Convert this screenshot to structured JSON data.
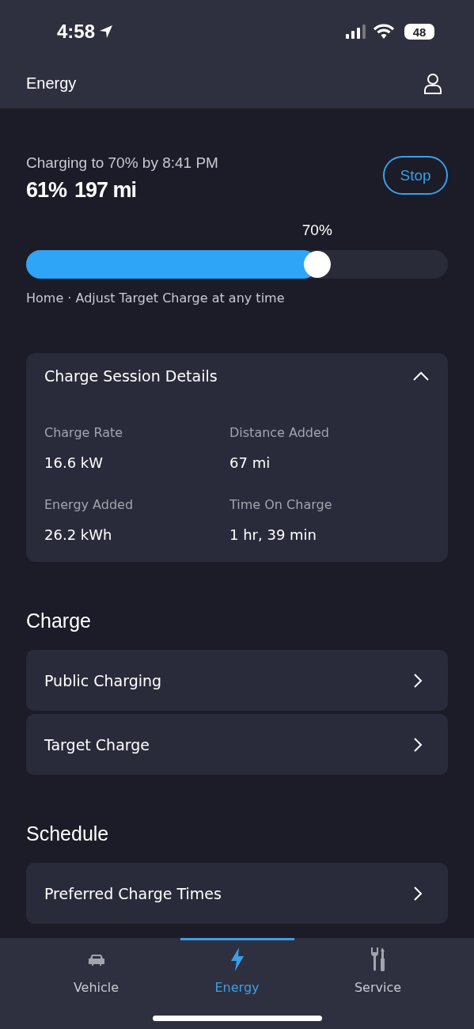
{
  "status_bar": {
    "time": "4:58",
    "battery": "48"
  },
  "header": {
    "title": "Energy"
  },
  "charging": {
    "status": "Charging to 70% by 8:41 PM",
    "percent": "61%",
    "range": "197 mi",
    "stop_button": "Stop",
    "target_label": "70%",
    "level": 0.69,
    "caption": "Home · Adjust Target Charge at any time"
  },
  "session": {
    "title": "Charge Session Details",
    "expanded": true,
    "details": [
      {
        "label": "Charge Rate",
        "value": "16.6 kW"
      },
      {
        "label": "Distance Added",
        "value": "67 mi"
      },
      {
        "label": "Energy Added",
        "value": "26.2 kWh"
      },
      {
        "label": "Time On Charge",
        "value": "1 hr, 39 min"
      }
    ]
  },
  "sections": [
    {
      "title": "Charge",
      "items": [
        {
          "label": "Public Charging"
        },
        {
          "label": "Target Charge"
        }
      ]
    },
    {
      "title": "Schedule",
      "items": [
        {
          "label": "Preferred Charge Times"
        }
      ]
    }
  ],
  "tab_bar": [
    {
      "kind": "car",
      "label": "Vehicle",
      "selected": false
    },
    {
      "kind": "bolt",
      "label": "Energy",
      "selected": true
    },
    {
      "kind": "tools",
      "label": "Service",
      "selected": false
    }
  ]
}
